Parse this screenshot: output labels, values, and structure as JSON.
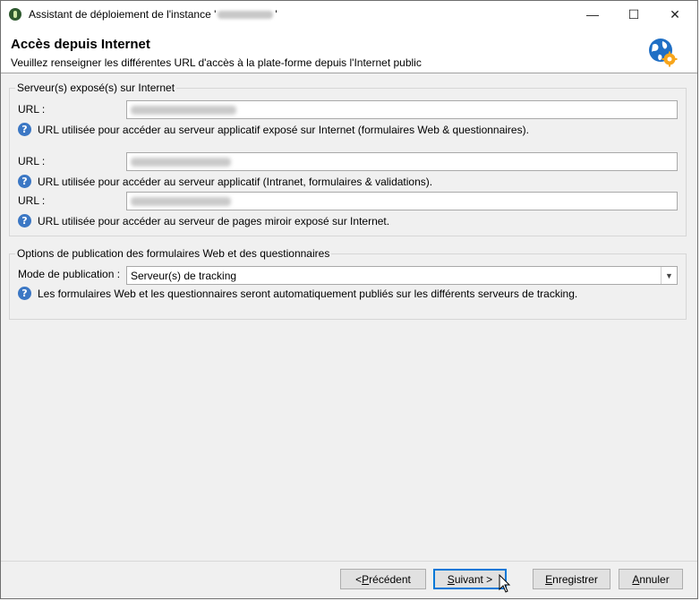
{
  "window": {
    "title_prefix": "Assistant de déploiement de l'instance '",
    "title_suffix": "'",
    "minimize_glyph": "—",
    "maximize_glyph": "☐",
    "close_glyph": "✕"
  },
  "header": {
    "title": "Accès depuis Internet",
    "subtitle": "Veuillez renseigner les différentes URL d'accès à la plate-forme depuis l'Internet public",
    "icon": "globe-gear-icon"
  },
  "exposed_servers": {
    "legend": "Serveur(s) exposé(s) sur Internet",
    "fields": [
      {
        "label": "URL :",
        "help": "URL utilisée pour accéder au serveur applicatif exposé sur Internet (formulaires Web & questionnaires)."
      },
      {
        "label": "URL :",
        "help": "URL utilisée pour accéder au serveur applicatif (Intranet, formulaires & validations)."
      },
      {
        "label": "URL :",
        "help": "URL utilisée pour accéder au serveur de pages miroir exposé sur Internet."
      }
    ]
  },
  "publication": {
    "legend": "Options de publication des formulaires Web et des questionnaires",
    "mode_label": "Mode de publication :",
    "mode_value": "Serveur(s) de tracking",
    "help": "Les formulaires Web et les questionnaires seront automatiquement publiés sur les différents serveurs de tracking."
  },
  "footer": {
    "prev": {
      "u": "P",
      "rest": "récédent",
      "prefix": "< "
    },
    "next": {
      "u": "S",
      "rest": "uivant >",
      "prefix": ""
    },
    "save": {
      "u": "E",
      "rest": "nregistrer",
      "prefix": ""
    },
    "cancel": {
      "u": "A",
      "rest": "nnuler",
      "prefix": ""
    }
  },
  "colors": {
    "help_icon": "#3b77c4",
    "primary_border": "#0078d7"
  }
}
